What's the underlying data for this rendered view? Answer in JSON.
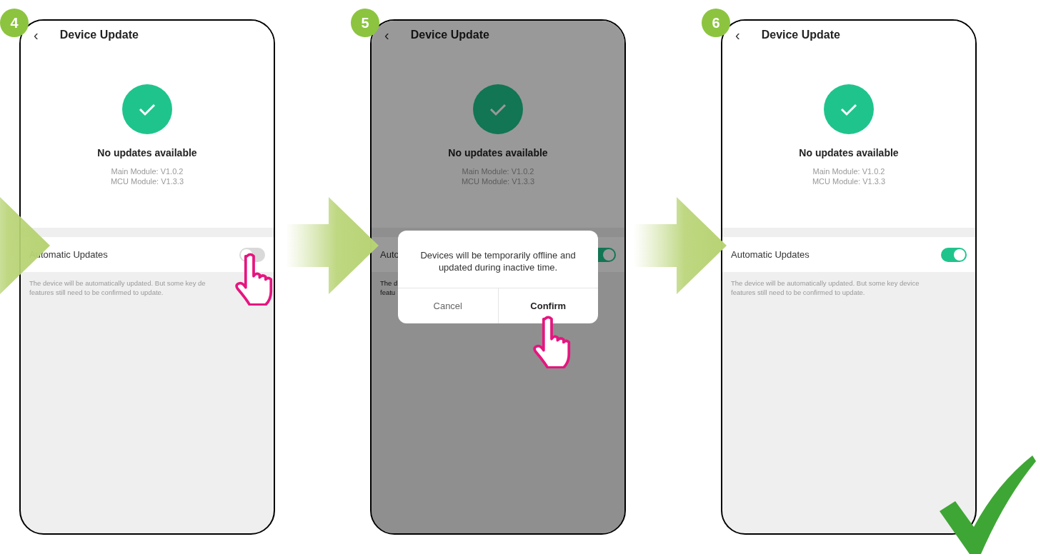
{
  "phones": [
    {
      "step": "4",
      "title": "Device Update",
      "status": "No updates available",
      "modules": [
        "Main Module: V1.0.2",
        "MCU Module: V1.3.3"
      ],
      "setting_label": "Automatic Updates",
      "toggle_on": false,
      "description": [
        "The device will be automatically updated. But some key de",
        "features still need to be confirmed to update."
      ],
      "dimmed": false,
      "back": "‹",
      "hand": {
        "kind": "toggle"
      }
    },
    {
      "step": "5",
      "title": "Device Update",
      "status": "No updates available",
      "modules": [
        "Main Module: V1.0.2",
        "MCU Module: V1.3.3"
      ],
      "setting_label": "Auto",
      "toggle_on": true,
      "description": [
        "The d",
        "featu"
      ],
      "dimmed": true,
      "back": "‹",
      "hand": {
        "kind": "confirm"
      },
      "dialog": {
        "message": "Devices will be temporarily offline and updated during inactive time.",
        "cancel": "Cancel",
        "confirm": "Confirm"
      }
    },
    {
      "step": "6",
      "title": "Device Update",
      "status": "No updates available",
      "modules": [
        "Main Module: V1.0.2",
        "MCU Module: V1.3.3"
      ],
      "setting_label": "Automatic Updates",
      "toggle_on": true,
      "description": [
        "The device will be automatically updated. But some key device",
        "features still need to be confirmed to update."
      ],
      "dimmed": false,
      "back": "‹"
    }
  ]
}
